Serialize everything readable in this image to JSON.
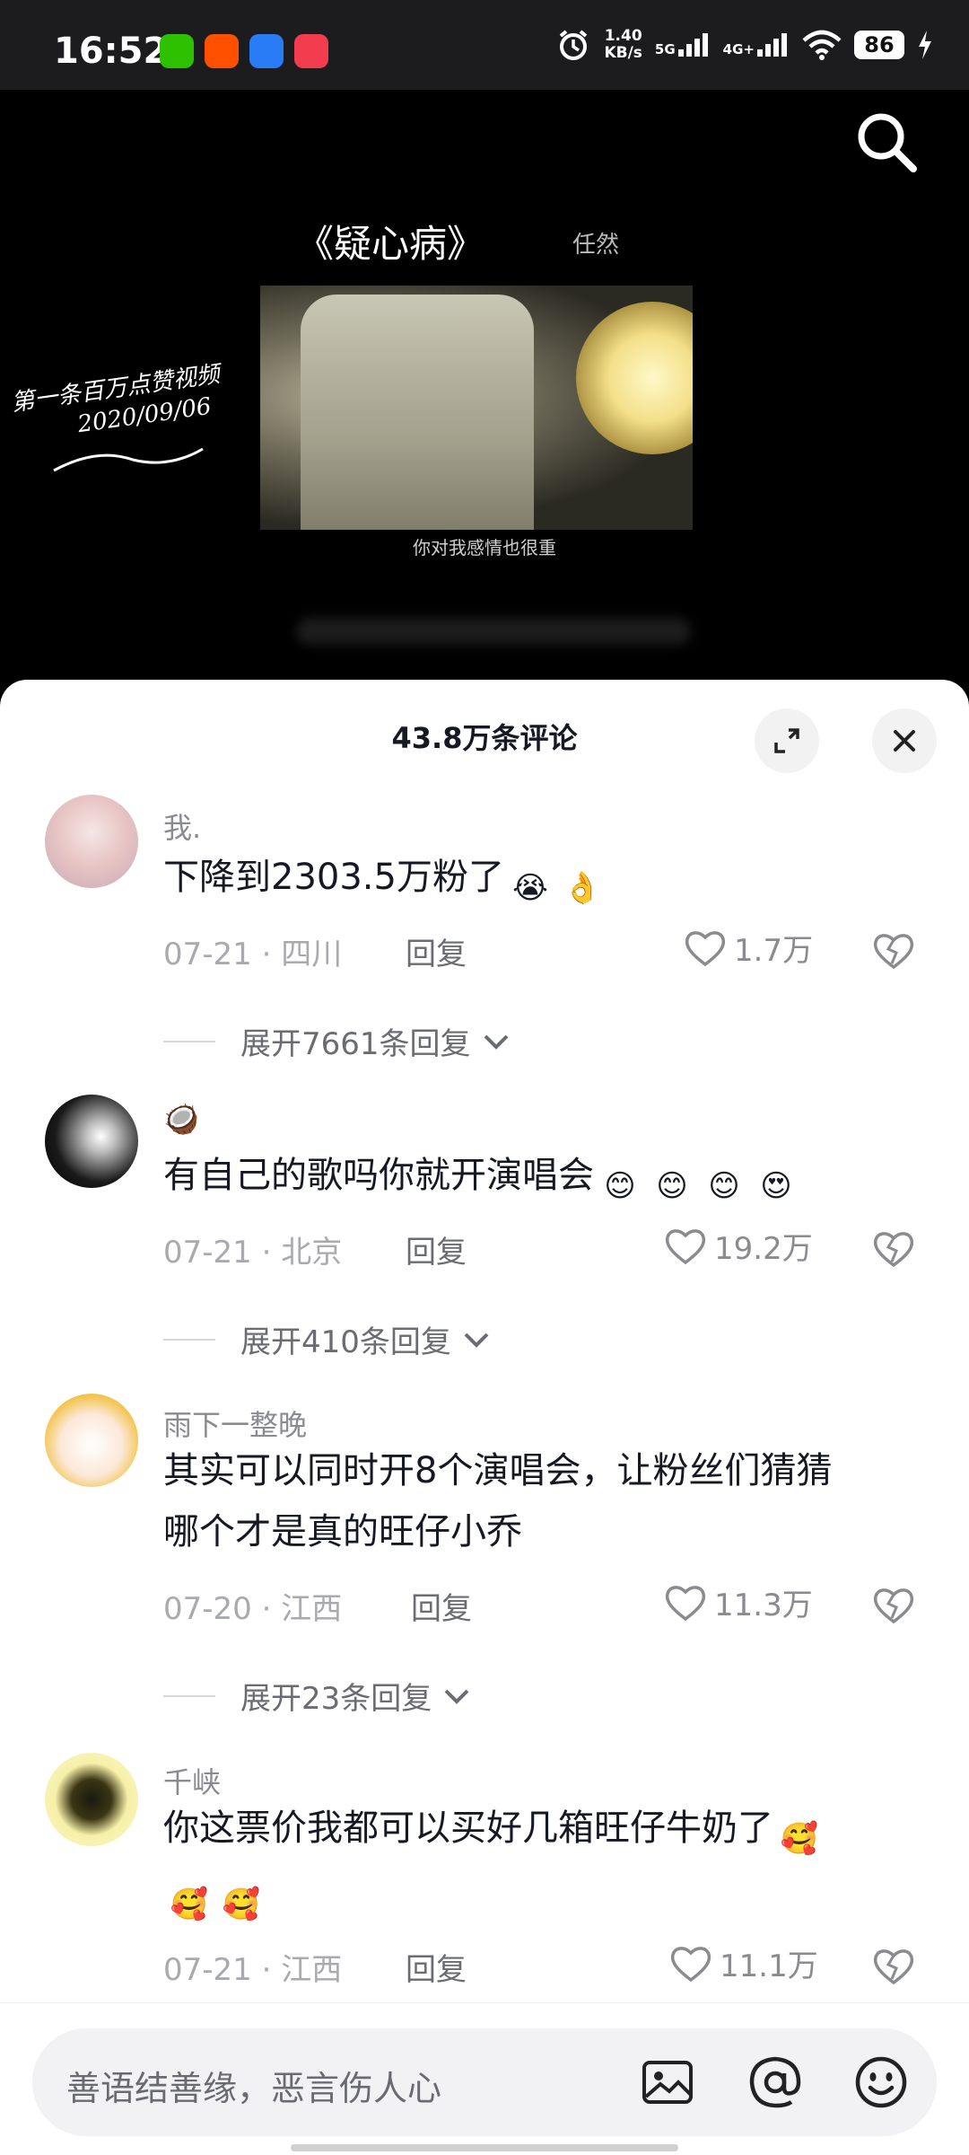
{
  "status_bar": {
    "time": "16:52",
    "net_speed_value": "1.40",
    "net_speed_unit": "KB/s",
    "signal1": "5G",
    "signal2": "4G+",
    "battery": "86",
    "app_icons": [
      "wechat-icon",
      "taobao-icon",
      "browser-icon",
      "video-app-icon"
    ]
  },
  "video": {
    "song_title": "《疑心病》",
    "artist": "任然",
    "handwriting_line1": "第一条百万点赞视频",
    "handwriting_line2": "2020/09/06",
    "subtitle": "你对我感情也很重"
  },
  "comments_header": {
    "title": "43.8万条评论"
  },
  "comments": [
    {
      "name": "我.",
      "text": "下降到2303.5万粉了",
      "emojis": [
        "😭",
        "👌"
      ],
      "date_loc": "07-21 · 四川",
      "reply": "回复",
      "likes": "1.7万",
      "expand": "展开7661条回复"
    },
    {
      "name": "🥥",
      "text": "有自己的歌吗你就开演唱会",
      "emojis": [
        "😊",
        "😊",
        "😊",
        "😍"
      ],
      "date_loc": "07-21 · 北京",
      "reply": "回复",
      "likes": "19.2万",
      "expand": "展开410条回复"
    },
    {
      "name": "雨下一整晚",
      "text_line1": "其实可以同时开8个演唱会，让粉丝们猜猜",
      "text_line2": "哪个才是真的旺仔小乔",
      "date_loc": "07-20 · 江西",
      "reply": "回复",
      "likes": "11.3万",
      "expand": "展开23条回复"
    },
    {
      "name": "千峡",
      "text": "你这票价我都可以买好几箱旺仔牛奶了",
      "emojis": [
        "🥰",
        "🥰",
        "🥰"
      ],
      "date_loc": "07-21 · 江西",
      "reply": "回复",
      "likes": "11.1万"
    }
  ],
  "input": {
    "placeholder": "善语结善缘，恶言伤人心"
  }
}
